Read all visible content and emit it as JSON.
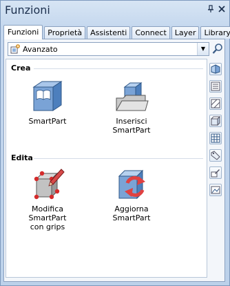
{
  "window": {
    "title": "Funzioni"
  },
  "titlebar_icons": [
    "pin-icon",
    "close-icon"
  ],
  "tabs": [
    {
      "label": "Funzioni",
      "active": true
    },
    {
      "label": "Proprietà",
      "active": false
    },
    {
      "label": "Assistenti",
      "active": false
    },
    {
      "label": "Connect",
      "active": false
    },
    {
      "label": "Layer",
      "active": false
    },
    {
      "label": "Library",
      "active": false
    }
  ],
  "combo": {
    "value": "Avanzato"
  },
  "sections": {
    "crea": {
      "title": "Crea"
    },
    "edita": {
      "title": "Edita"
    }
  },
  "items": {
    "smartpart": {
      "label": "SmartPart"
    },
    "inserisci": {
      "label1": "Inserisci",
      "label2": "SmartPart"
    },
    "modifica": {
      "label1": "Modifica SmartPart",
      "label2": "con grips"
    },
    "aggiorna": {
      "label1": "Aggiorna",
      "label2": "SmartPart"
    }
  },
  "sidebar_icons": [
    "3d-view-icon",
    "properties-icon",
    "hatch-icon",
    "cube-icon",
    "grid-icon",
    "tag-icon",
    "edit-layer-icon",
    "picture-icon"
  ],
  "colors": {
    "accent": "#4b7fc0",
    "grip": "#d42b2b",
    "refresh": "#e04141"
  }
}
